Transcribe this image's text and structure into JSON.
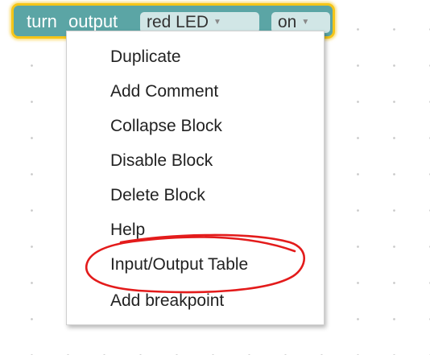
{
  "block": {
    "word_turn": "turn",
    "word_output": "output",
    "dropdown_device": "red LED",
    "dropdown_state": "on",
    "dropdown_arrow": "▼",
    "colors": {
      "block_fill": "#5ba5a5",
      "selection_outline": "#f5c518"
    }
  },
  "context_menu": {
    "items": [
      {
        "label": "Duplicate"
      },
      {
        "label": "Add Comment"
      },
      {
        "label": "Collapse Block"
      },
      {
        "label": "Disable Block"
      },
      {
        "label": "Delete Block"
      },
      {
        "label": "Help"
      },
      {
        "label": "Input/Output Table"
      },
      {
        "label": "Add breakpoint"
      }
    ]
  },
  "annotation": {
    "type": "hand-drawn ellipse",
    "color": "#e31b1b",
    "encircles": "Input/Output Table"
  }
}
